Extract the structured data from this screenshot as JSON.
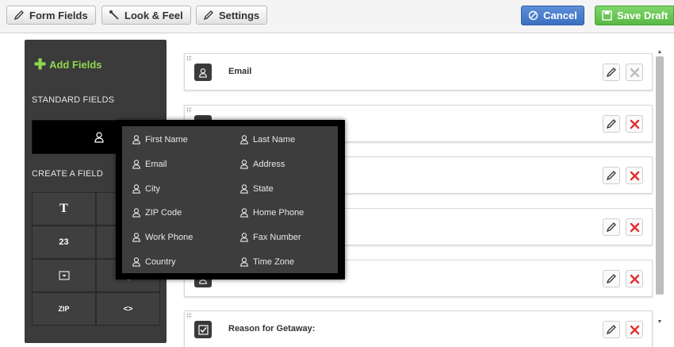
{
  "toolbar": {
    "form_fields": "Form Fields",
    "look_feel": "Look & Feel",
    "settings": "Settings",
    "cancel": "Cancel",
    "save_draft": "Save Draft"
  },
  "sidebar": {
    "add_fields": "Add Fields",
    "standard_fields": "STANDARD FIELDS",
    "create_field": "CREATE A FIELD",
    "grid": [
      "T",
      "",
      "23",
      "",
      "",
      "",
      "ZIP",
      "<>"
    ]
  },
  "popup": {
    "left": [
      "First Name",
      "Email",
      "City",
      "ZIP Code",
      "Work Phone",
      "Country"
    ],
    "right": [
      "Last Name",
      "Address",
      "State",
      "Home Phone",
      "Fax Number",
      "Time Zone"
    ]
  },
  "fields": [
    {
      "label": "Email",
      "icon": "user-icon"
    },
    {
      "label": "",
      "icon": "user-icon"
    },
    {
      "label": "",
      "icon": "user-icon"
    },
    {
      "label": "",
      "icon": "user-icon"
    },
    {
      "label": "",
      "icon": "user-icon"
    },
    {
      "label": "Reason for Getaway:",
      "icon": "checkbox-icon"
    }
  ],
  "colors": {
    "accent_green": "#8fd64e",
    "cancel_blue": "#3b6fc1",
    "save_green": "#59b845",
    "delete_red": "#e03030"
  }
}
